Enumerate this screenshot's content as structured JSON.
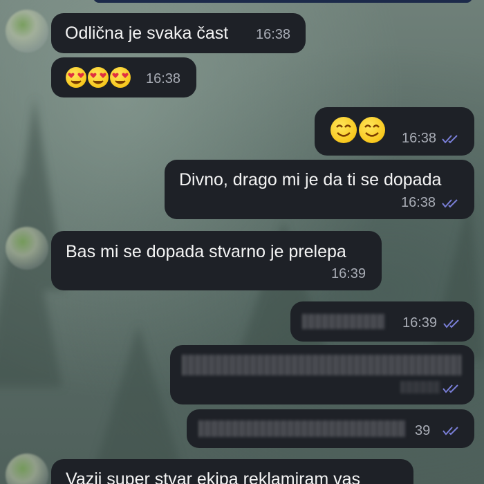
{
  "messages": [
    {
      "direction": "incoming",
      "text": "Odlična je svaka čast",
      "time": "16:38"
    },
    {
      "direction": "incoming",
      "emoji": [
        "heart-eyes",
        "heart-eyes",
        "heart-eyes"
      ],
      "time": "16:38"
    },
    {
      "direction": "outgoing",
      "emoji": [
        "smiling-face",
        "smiling-face"
      ],
      "time": "16:38",
      "status": "read"
    },
    {
      "direction": "outgoing",
      "text": "Divno, drago mi je da ti se dopada",
      "time": "16:38",
      "status": "read"
    },
    {
      "direction": "incoming",
      "text": "Bas mi se dopada stvarno je prelepa",
      "time": "16:39"
    },
    {
      "direction": "outgoing",
      "text_redacted": true,
      "time": "16:39",
      "status": "read"
    },
    {
      "direction": "outgoing",
      "text_redacted": true,
      "status": "read"
    },
    {
      "direction": "outgoing",
      "text_redacted": true,
      "time": "39",
      "status": "read"
    },
    {
      "direction": "incoming",
      "text": "Vazii super stvar ekipa reklamiram vas"
    }
  ],
  "colors": {
    "bubble": "#1e2127",
    "text": "#f4f4f4",
    "time": "#a9adb6",
    "read_check": "#7a7fd8"
  }
}
